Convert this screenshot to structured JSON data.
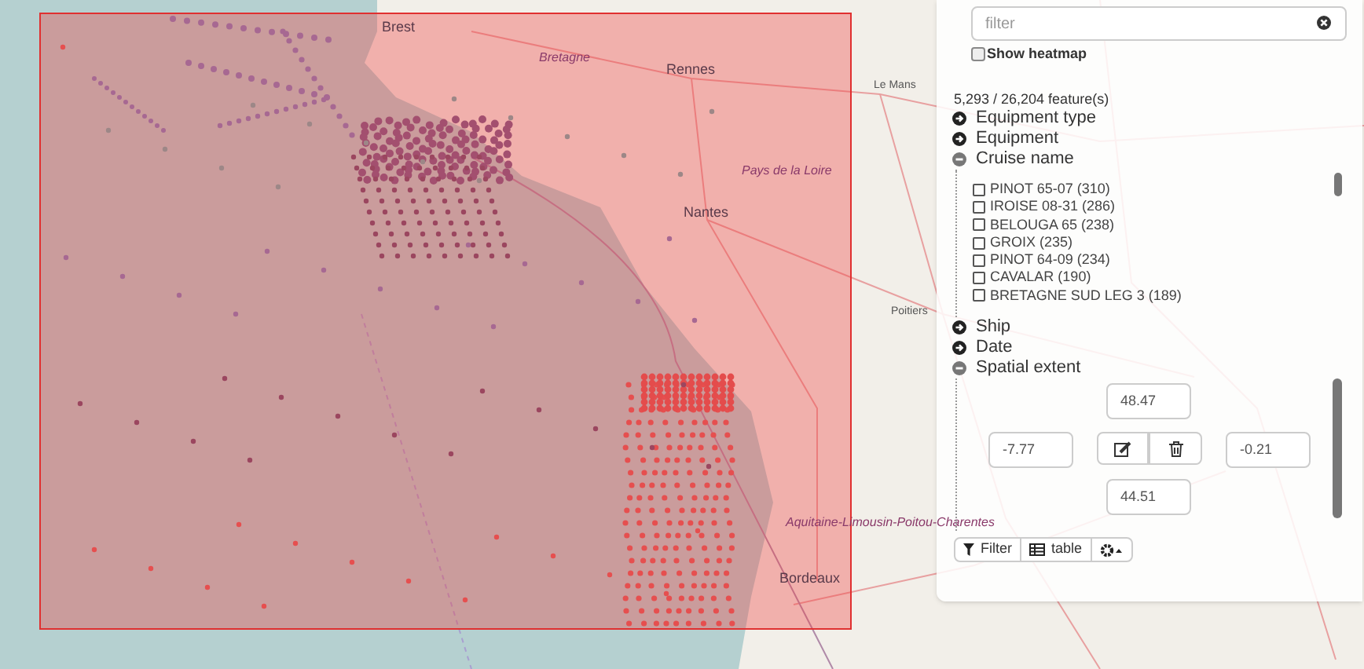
{
  "map": {
    "labels": [
      {
        "text": "Brest",
        "kind": "city"
      },
      {
        "text": "Bretagne",
        "kind": "region"
      },
      {
        "text": "Rennes",
        "kind": "city"
      },
      {
        "text": "Le Mans",
        "kind": "town"
      },
      {
        "text": "Pays de la Loire",
        "kind": "region"
      },
      {
        "text": "Nantes",
        "kind": "city"
      },
      {
        "text": "Poitiers",
        "kind": "town"
      },
      {
        "text": "Aquitaine-Limousin-Poitou-Charentes",
        "kind": "region"
      },
      {
        "text": "Bordeaux",
        "kind": "city"
      }
    ]
  },
  "filter": {
    "placeholder": "filter"
  },
  "heatmap": {
    "label": "Show heatmap",
    "checked": false
  },
  "count": "5,293 / 26,204 feature(s)",
  "facets": [
    {
      "label": "Equipment type",
      "expanded": false
    },
    {
      "label": "Equipment",
      "expanded": false
    },
    {
      "label": "Cruise name",
      "expanded": true,
      "kind": "list",
      "options": [
        {
          "label": "PINOT 65-07 (310)",
          "checked": false
        },
        {
          "label": "IROISE 08-31 (286)",
          "checked": false
        },
        {
          "label": "BELOUGA 65 (238)",
          "checked": false
        },
        {
          "label": "GROIX (235)",
          "checked": false
        },
        {
          "label": "PINOT 64-09 (234)",
          "checked": false
        },
        {
          "label": "CAVALAR (190)",
          "checked": false
        },
        {
          "label": "BRETAGNE SUD LEG 3 (189)",
          "checked": false
        }
      ]
    },
    {
      "label": "Ship",
      "expanded": false
    },
    {
      "label": "Date",
      "expanded": false
    },
    {
      "label": "Spatial extent",
      "expanded": true,
      "kind": "extent",
      "north": "48.47",
      "west": "-7.77",
      "east": "-0.21",
      "south": "44.51"
    }
  ],
  "toolbar": [
    {
      "kind": "filter",
      "label": "Filter"
    },
    {
      "kind": "table",
      "label": "table"
    },
    {
      "kind": "settings"
    }
  ]
}
